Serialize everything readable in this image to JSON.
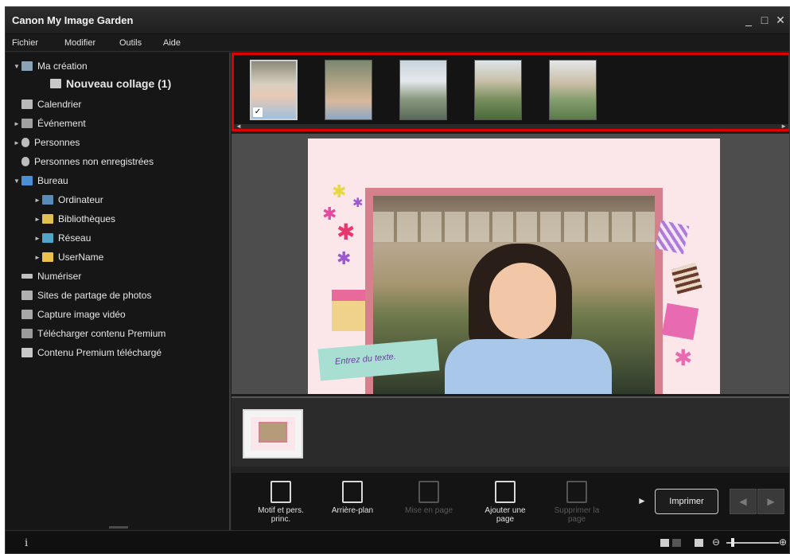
{
  "app": {
    "title": "Canon My Image Garden"
  },
  "window_controls": {
    "minimize": "_",
    "maximize": "□",
    "close": "✕"
  },
  "menu": [
    "Fichier",
    "Modifier",
    "Outils",
    "Aide"
  ],
  "sidebar": {
    "items": [
      {
        "label": "Ma création",
        "icon": "my-creation-icon",
        "caret": "▼"
      },
      {
        "label": "Nouveau collage (1)",
        "icon": "collage-icon",
        "caret": ""
      },
      {
        "label": "Calendrier",
        "icon": "calendar-icon",
        "caret": ""
      },
      {
        "label": "Événement",
        "icon": "event-icon",
        "caret": "►"
      },
      {
        "label": "Personnes",
        "icon": "person-icon",
        "caret": "►"
      },
      {
        "label": "Personnes non enregistrées",
        "icon": "unregistered-person-icon",
        "caret": ""
      },
      {
        "label": "Bureau",
        "icon": "desktop-icon",
        "caret": "▼"
      },
      {
        "label": "Ordinateur",
        "icon": "computer-icon",
        "caret": "►"
      },
      {
        "label": "Bibliothèques",
        "icon": "libraries-icon",
        "caret": "►"
      },
      {
        "label": "Réseau",
        "icon": "network-icon",
        "caret": "►"
      },
      {
        "label": "UserName",
        "icon": "user-folder-icon",
        "caret": "►"
      },
      {
        "label": "Numériser",
        "icon": "scan-icon",
        "caret": ""
      },
      {
        "label": "Sites de partage de photos",
        "icon": "photo-sharing-icon",
        "caret": ""
      },
      {
        "label": "Capture image vidéo",
        "icon": "video-capture-icon",
        "caret": ""
      },
      {
        "label": "Télécharger contenu Premium",
        "icon": "download-premium-icon",
        "caret": ""
      },
      {
        "label": "Contenu Premium téléchargé",
        "icon": "premium-folder-icon",
        "caret": ""
      }
    ]
  },
  "thumbnails": {
    "selected_mark": "✓",
    "count": 5,
    "selected_index": 0
  },
  "canvas": {
    "text_placeholder": "Entrez du texte."
  },
  "toolbar": {
    "tools": [
      {
        "label": "Motif et pers. princ.",
        "enabled": true
      },
      {
        "label": "Arrière-plan",
        "enabled": true
      },
      {
        "label": "Mise en page",
        "enabled": false
      },
      {
        "label": "Ajouter une page",
        "enabled": true
      },
      {
        "label": "Supprimer la page",
        "enabled": false
      }
    ],
    "more": "►",
    "print": "Imprimer",
    "prev": "◀",
    "next": "▶"
  },
  "status": {
    "info": "i",
    "zoom_out": "⊖",
    "zoom_in": "⊕"
  },
  "colors": {
    "highlight_box": "#e00000",
    "background": "#1c1c1c",
    "canvas": "#fbe6ea"
  }
}
